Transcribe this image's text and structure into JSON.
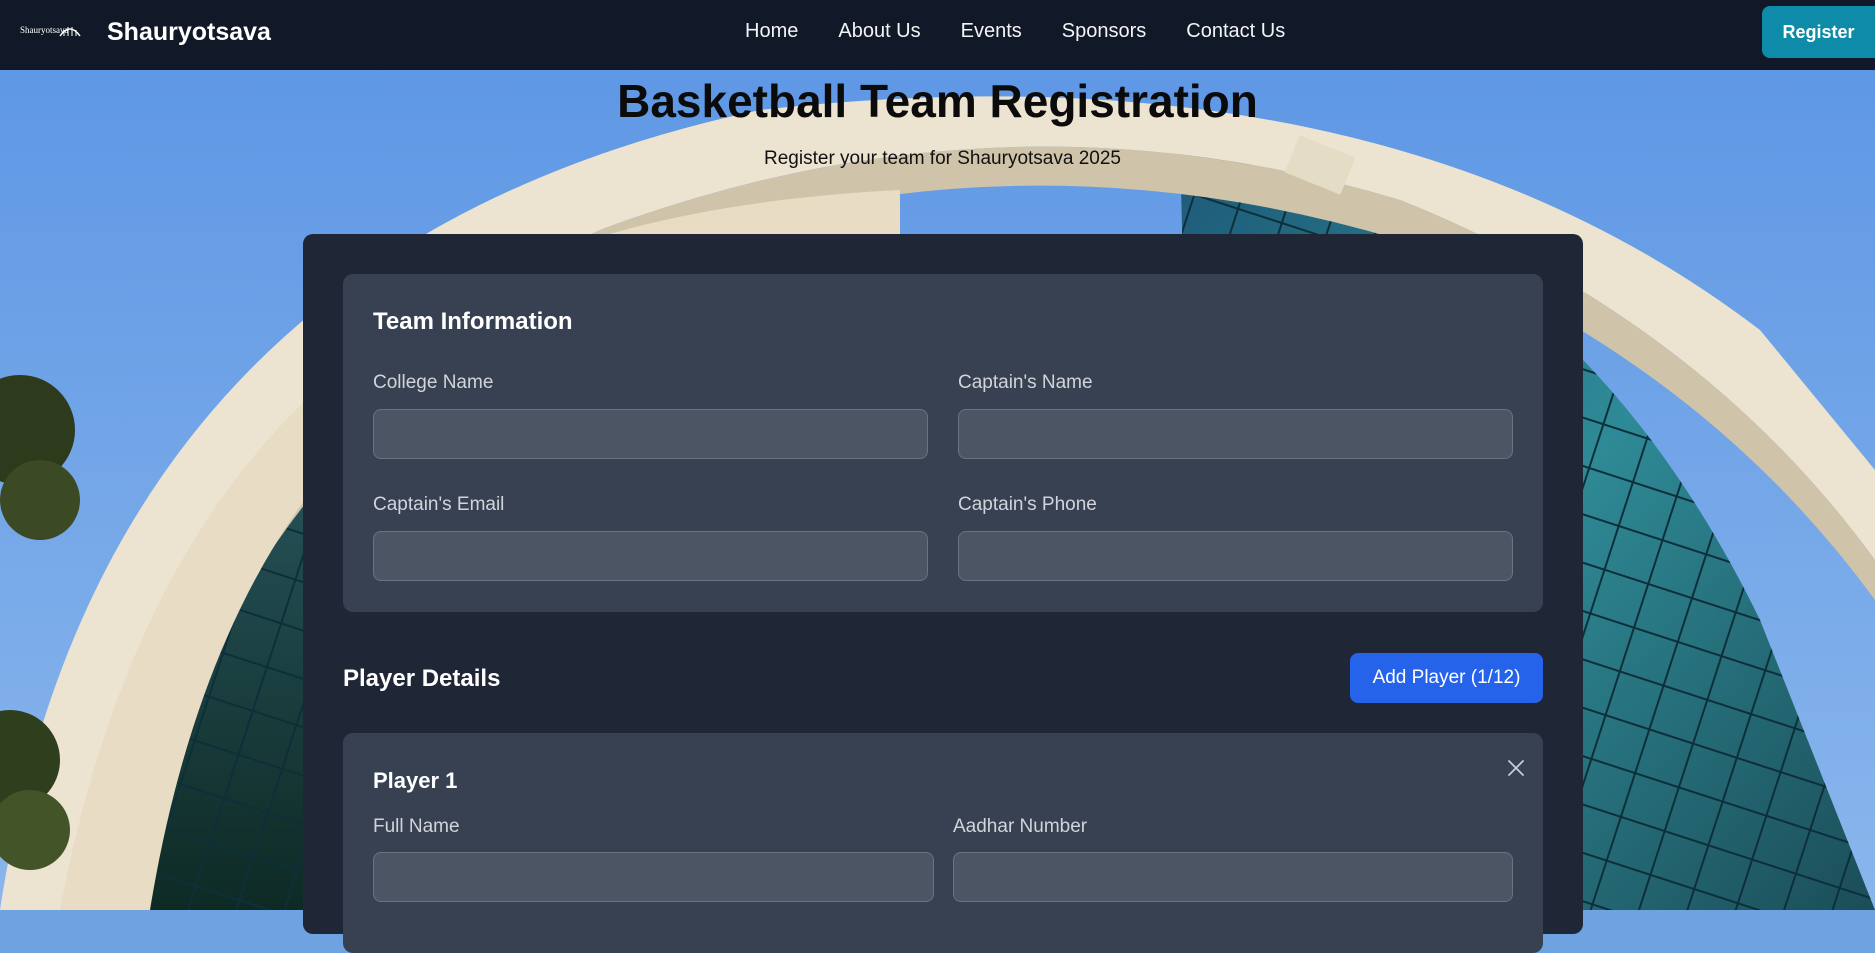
{
  "nav": {
    "brand": "Shauryotsava",
    "logo_text": "Shauryotsava",
    "links": [
      "Home",
      "About Us",
      "Events",
      "Sponsors",
      "Contact Us"
    ],
    "register": "Register"
  },
  "hero": {
    "title": "Basketball Team Registration",
    "subtitle": "Register your team for Shauryotsava 2025"
  },
  "team_info": {
    "heading": "Team Information",
    "college_label": "College Name",
    "college_value": "",
    "captain_name_label": "Captain's Name",
    "captain_name_value": "",
    "captain_email_label": "Captain's Email",
    "captain_email_value": "",
    "captain_phone_label": "Captain's Phone",
    "captain_phone_value": ""
  },
  "players": {
    "heading": "Player Details",
    "add_button": "Add Player (1/12)",
    "list": [
      {
        "title": "Player 1",
        "full_name_label": "Full Name",
        "full_name_value": "",
        "aadhar_label": "Aadhar Number",
        "aadhar_value": ""
      }
    ]
  },
  "icons": {
    "logo": "shauryotsava-logo",
    "close": "close-icon"
  },
  "colors": {
    "navbar": "#111827",
    "register_button": "#0e8ba8",
    "card": "#1f2635",
    "panel": "#374151",
    "input": "#4b5563",
    "add_button": "#2563eb"
  }
}
